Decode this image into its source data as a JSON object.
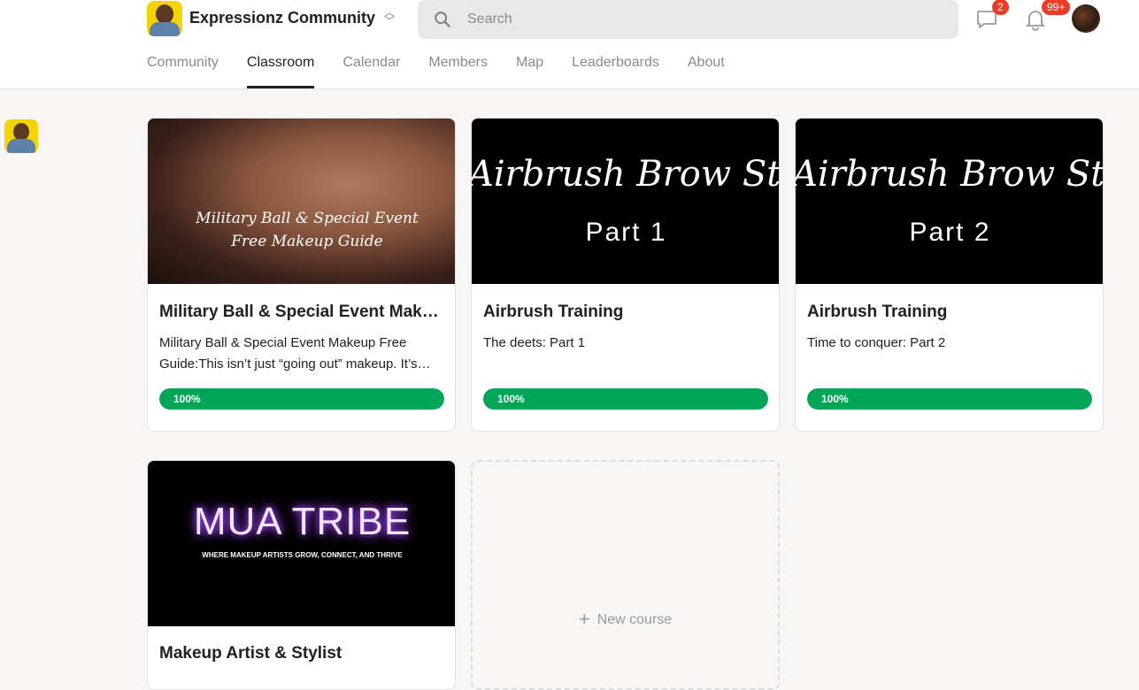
{
  "header": {
    "community_name": "Expressionz Community",
    "search_placeholder": "Search",
    "chat_badge": "2",
    "notif_badge": "99+"
  },
  "tabs": [
    {
      "label": "Community"
    },
    {
      "label": "Classroom",
      "active": true
    },
    {
      "label": "Calendar"
    },
    {
      "label": "Members"
    },
    {
      "label": "Map"
    },
    {
      "label": "Leaderboards"
    },
    {
      "label": "About"
    }
  ],
  "courses": [
    {
      "cover_text": "Military Ball & Special Event Free Makeup Guide",
      "title": "Military Ball & Special Event Makeup Free Guide",
      "description": "Military Ball & Special Event Makeup Free Guide:This isn’t just “going out” makeup. It’s…",
      "progress": 100,
      "progress_label": "100%"
    },
    {
      "cover_script": "Airbrush Brow Stain",
      "cover_part": "Part 1",
      "title": "Airbrush Training",
      "description": "The deets: Part 1",
      "progress": 100,
      "progress_label": "100%"
    },
    {
      "cover_script": "Airbrush Brow Stain",
      "cover_part": "Part 2",
      "title": "Airbrush Training",
      "description": "Time to conquer: Part 2",
      "progress": 100,
      "progress_label": "100%"
    },
    {
      "cover_title": "MUA TRIBE",
      "cover_subtitle": "WHERE MAKEUP ARTISTS GROW, CONNECT, AND THRIVE",
      "title": "Makeup Artist & Stylist"
    }
  ],
  "new_course": {
    "label": "New course"
  },
  "colors": {
    "progress": "#00a556",
    "badge": "#ef3b24",
    "accent": "#202124"
  }
}
